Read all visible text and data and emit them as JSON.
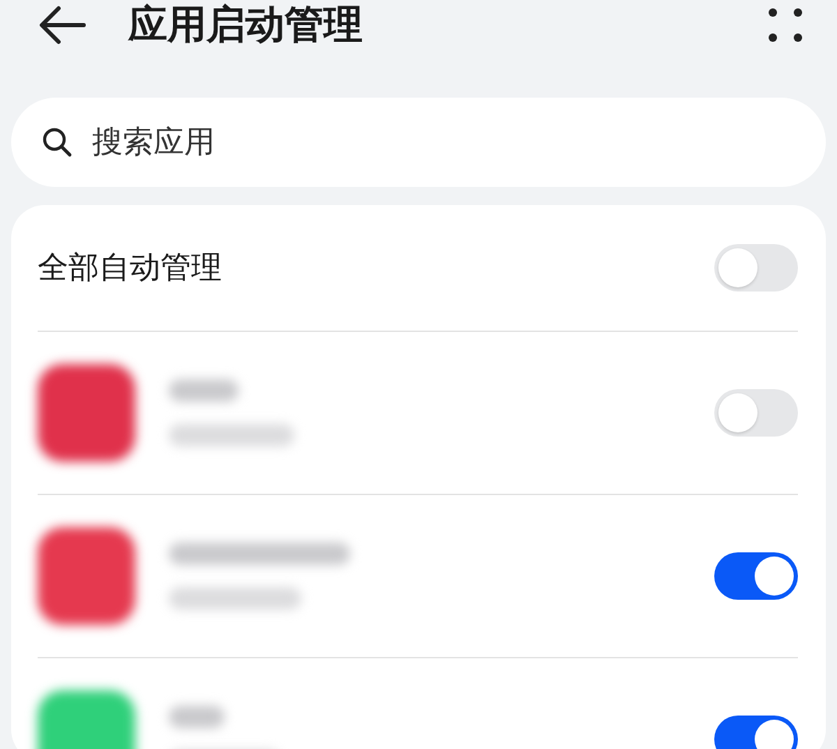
{
  "header": {
    "title": "应用启动管理"
  },
  "search": {
    "placeholder": "搜索应用"
  },
  "all_auto": {
    "label": "全部自动管理",
    "on": false
  },
  "apps": [
    {
      "color": "#e0314b",
      "on": false
    },
    {
      "color": "#e5394f",
      "on": true
    },
    {
      "color": "#2fd07a",
      "on": true
    }
  ]
}
